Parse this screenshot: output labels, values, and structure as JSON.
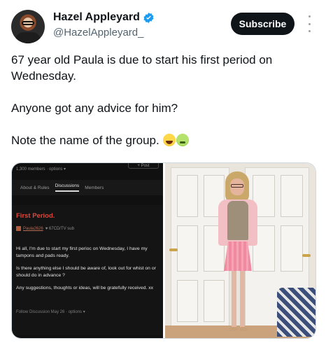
{
  "author": {
    "display_name": "Hazel Appleyard",
    "handle": "@HazelAppleyard_",
    "verified": true,
    "avatar_icon": "profile-avatar"
  },
  "actions": {
    "subscribe_label": "Subscribe",
    "more_icon": "more-vertical-icon"
  },
  "tweet": {
    "line1": "67 year old Paula is due to start his first period on Wednesday.",
    "line2": "Anyone got any advice for him?",
    "line3": "Note the name of the group.",
    "emojis": [
      "face-with-tears-of-joy",
      "nauseated-face"
    ]
  },
  "media": {
    "screenshot": {
      "top_meta": "1,300 members · options ▾",
      "post_button": "+ Post",
      "tabs": [
        "About & Rules",
        "Discussions",
        "Members"
      ],
      "active_tab": "Discussions",
      "post_title": "First Period.",
      "post_author": "Paula2626",
      "post_author_meta": "♥ 67CD/TV sub",
      "body_p1": "Hi all, I'm due to start my first perioc on Wednesday, I have my tampons and pads ready.",
      "body_p2": "Is there anything else I should be aware of, look out for whist on or should do in advance ?",
      "body_p3": "Any suggestions, thoughts or ideas, will be gratefully received. xx",
      "footer": "Follow Discussion   May 26 · options ▾"
    },
    "photo_description_icon": "photo-image"
  },
  "colors": {
    "text_primary": "#0f1419",
    "text_secondary": "#536471",
    "verified_blue": "#1d9bf0",
    "subscribe_bg": "#0f1419",
    "post_title_red": "#e0473c"
  }
}
